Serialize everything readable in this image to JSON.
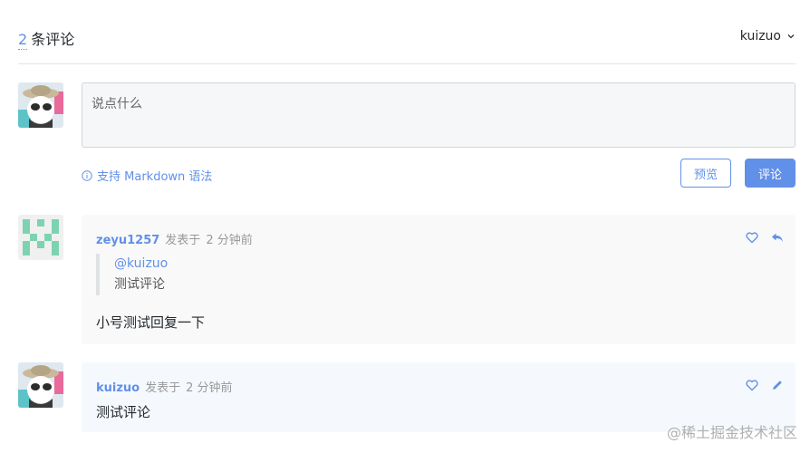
{
  "header": {
    "count": "2",
    "count_suffix": "条评论",
    "username": "kuizuo"
  },
  "editor": {
    "placeholder": "说点什么",
    "markdown_hint": "支持 Markdown 语法",
    "preview_label": "预览",
    "submit_label": "评论"
  },
  "comments": [
    {
      "author": "zeyu1257",
      "posted_label": "发表于",
      "time": "2 分钟前",
      "quote_mention": "@kuizuo",
      "quote_text": "测试评论",
      "text": "小号测试回复一下"
    },
    {
      "author": "kuizuo",
      "posted_label": "发表于",
      "time": "2 分钟前",
      "text": "测试评论"
    }
  ],
  "watermark": "@稀土掘金技术社区",
  "colors": {
    "accent": "#6190e8",
    "comment_bg_1": "#f9f9f9",
    "comment_bg_2": "#f5f9fe"
  }
}
